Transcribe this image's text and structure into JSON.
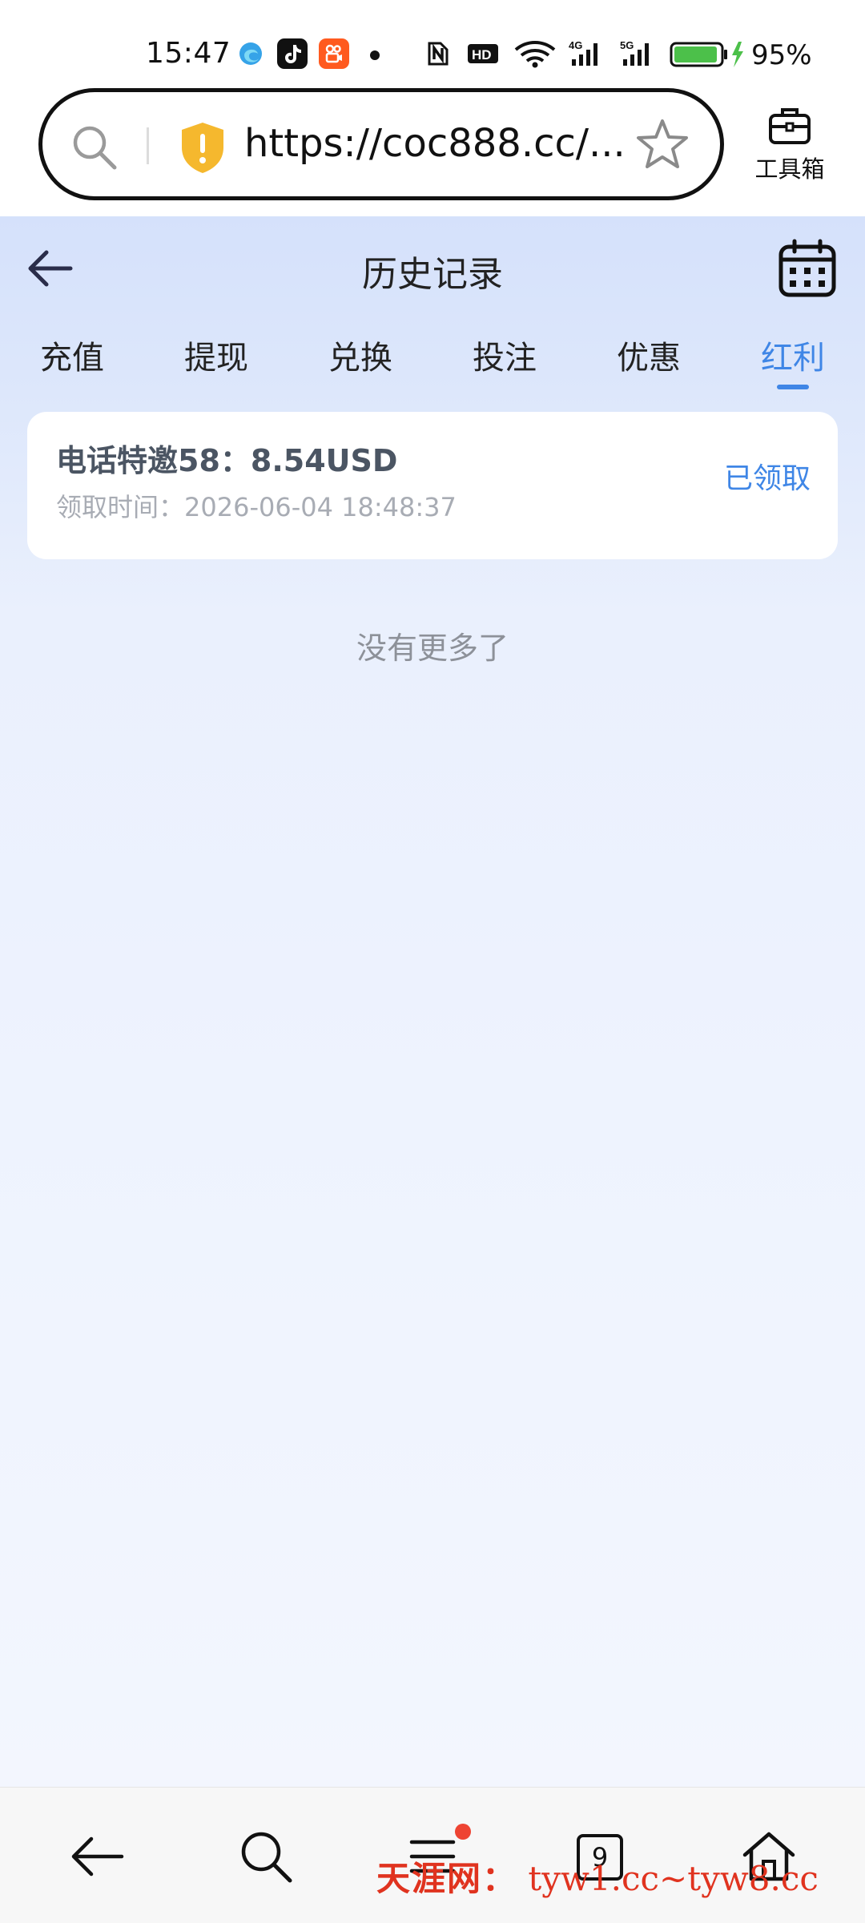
{
  "status_bar": {
    "time": "15:47",
    "apps": [
      "edge-app-icon",
      "tiktok-app-icon",
      "kuaishou-app-icon"
    ],
    "indicators": [
      "nfc-icon",
      "hd-icon",
      "wifi-icon",
      "4g-signal-icon",
      "5g-signal-icon"
    ],
    "battery_percent": "95%",
    "battery_level": 0.95
  },
  "browser": {
    "url": "https://coc888.cc/...",
    "toolbox_label": "工具箱"
  },
  "page": {
    "title": "历史记录",
    "tabs": [
      {
        "label": "充值",
        "active": false
      },
      {
        "label": "提现",
        "active": false
      },
      {
        "label": "兑换",
        "active": false
      },
      {
        "label": "投注",
        "active": false
      },
      {
        "label": "优惠",
        "active": false
      },
      {
        "label": "红利",
        "active": true
      }
    ],
    "records": [
      {
        "title": "电话特邀58：8.54USD",
        "time_label": "领取时间：",
        "time_value": "2026-06-04 18:48:37",
        "status": "已领取"
      }
    ],
    "empty_text": "没有更多了"
  },
  "bottom_nav": {
    "tab_count": "9",
    "watermark_brand": "天涯网：",
    "watermark_domains": "tyw1.cc~tyw8.cc"
  },
  "colors": {
    "accent": "#3f86e6",
    "page_bg_top": "#d5e1fb",
    "page_bg_bottom": "#f3f6fe",
    "watermark": "#e0331f",
    "battery": "#4cc04a"
  }
}
